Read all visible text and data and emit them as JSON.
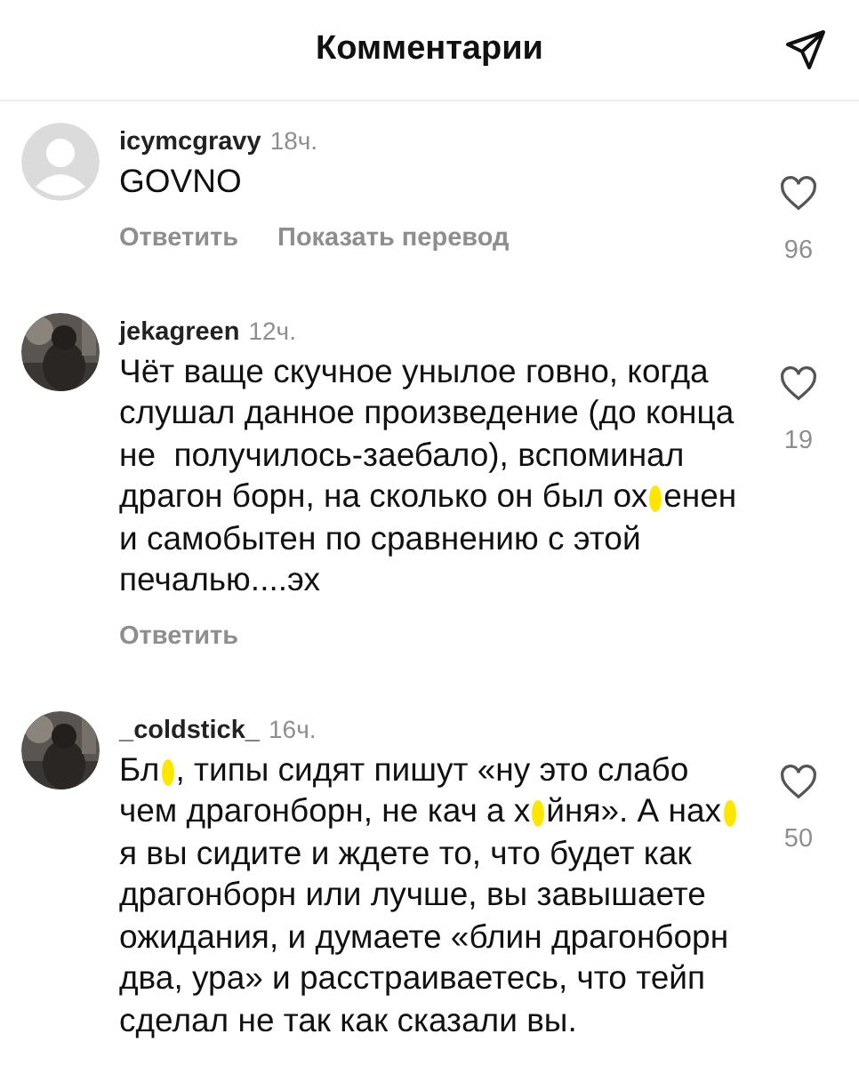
{
  "header": {
    "title": "Комментарии"
  },
  "comments": [
    {
      "avatar": {
        "kind": "default"
      },
      "username": "icymcgravy",
      "time": "18ч.",
      "text_parts": [
        "GOVNO"
      ],
      "likes": "96",
      "actions": [
        "Ответить",
        "Показать перевод"
      ]
    },
    {
      "avatar": {
        "kind": "picture"
      },
      "username": "jekagreen",
      "time": "12ч.",
      "text_parts": [
        "Чёт ваще скучное унылое говно, когда слушал данное произведение (до конца не  получилось-заебало), вспоминал драгон борн, на сколько он был ох",
        "енен и самобытен по сравнению с этой печалью....эх"
      ],
      "likes": "19",
      "actions": [
        "Ответить"
      ]
    },
    {
      "avatar": {
        "kind": "picture"
      },
      "username": "_coldstick_",
      "time": "16ч.",
      "text_parts": [
        "Бл",
        ", типы сидят пишут «ну это слабо чем драгонборн, не кач а х",
        "йня». А нах",
        "я вы сидите и ждете то, что будет как драгонборн или лучше, вы завышаете ожидания, и думаете «блин драгонборн два, ура» и расстраиваетесь, что тейп сделал не так как сказали вы."
      ],
      "likes": "50"
    }
  ]
}
